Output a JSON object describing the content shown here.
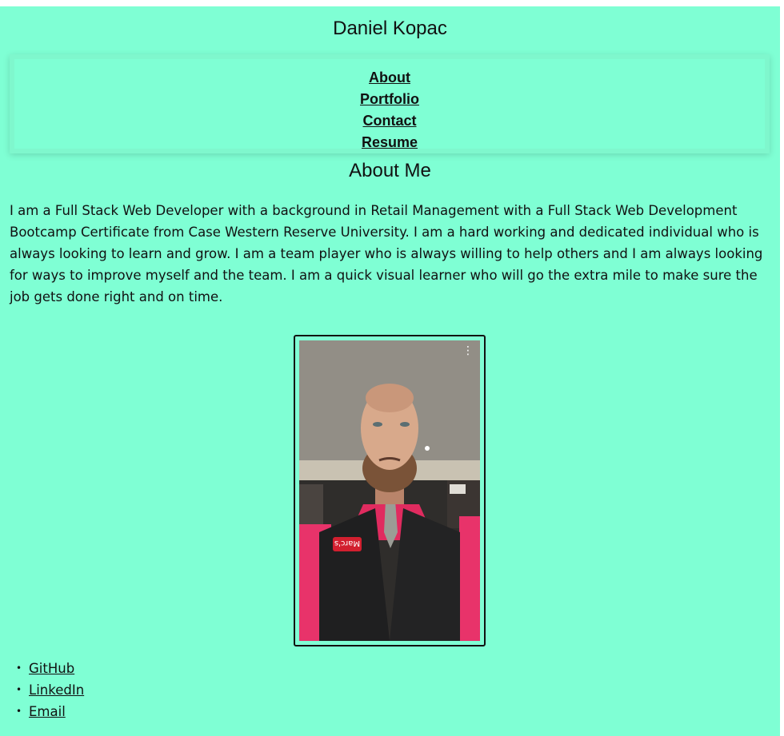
{
  "header": {
    "title": "Daniel Kopac"
  },
  "nav": {
    "items": [
      {
        "label": "About"
      },
      {
        "label": "Portfolio"
      },
      {
        "label": "Contact"
      },
      {
        "label": "Resume"
      }
    ]
  },
  "about": {
    "title": "About Me",
    "text": "I am a Full Stack Web Developer with a background in Retail Management with a Full Stack Web Development Bootcamp Certificate from Case Western Reserve University. I am a hard working and dedicated individual who is always looking to learn and grow. I am a team player who is always willing to help others and I am always looking for ways to improve myself and the team. I am a quick visual learner who will go the extra mile to make sure the job gets done right and on time."
  },
  "video": {
    "more_icon": "vertical-ellipsis-icon",
    "shirt_logo_text": "Marc's"
  },
  "social": {
    "links": [
      {
        "label": "GitHub"
      },
      {
        "label": "LinkedIn"
      },
      {
        "label": "Email"
      }
    ]
  },
  "colors": {
    "background": "#7fffd4",
    "text": "#111111"
  }
}
